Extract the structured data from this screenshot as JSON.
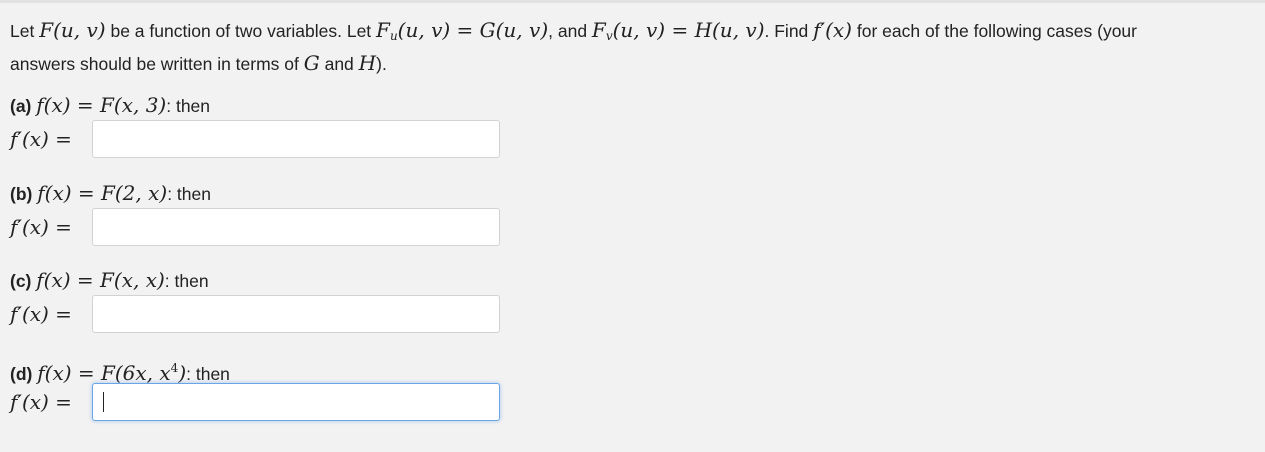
{
  "intro": {
    "t1": "Let ",
    "m1": "F(u, v)",
    "t2": " be a function of two variables. Let ",
    "m2a": "F",
    "m2sub": "u",
    "m2b": "(u, v) = G(u, v)",
    "t3": ", and ",
    "m3a": "F",
    "m3sub": "v",
    "m3b": "(u, v) = H(u, v)",
    "t4": ". Find ",
    "m4": "f′(x)",
    "t5": " for each of the following cases (your",
    "t6": "answers should be written in terms of ",
    "m5": "G",
    "t7": " and ",
    "m6": "H",
    "t8": ")."
  },
  "parts": [
    {
      "label": "(a)",
      "expr": "f(x) = F(x, 3)",
      "suffix": ": then",
      "answer_prefix": "f′(x) =",
      "value": ""
    },
    {
      "label": "(b)",
      "expr": "f(x) = F(2, x)",
      "suffix": ": then",
      "answer_prefix": "f′(x) =",
      "value": ""
    },
    {
      "label": "(c)",
      "expr": "f(x) = F(x, x)",
      "suffix": ": then",
      "answer_prefix": "f′(x) =",
      "value": ""
    },
    {
      "label": "(d)",
      "expr_a": "f(x) = F(6x, x",
      "expr_sup": "4",
      "expr_b": ")",
      "suffix": ": then",
      "answer_prefix": "f′(x) =",
      "value": ""
    }
  ]
}
